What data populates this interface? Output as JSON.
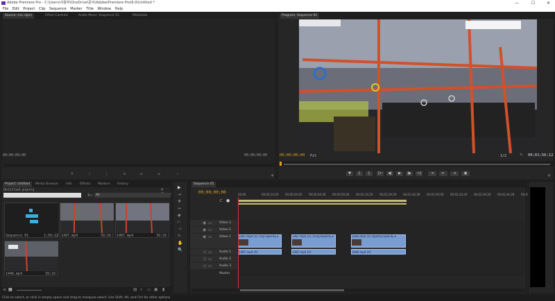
{
  "window": {
    "title": "Adobe Premiere Pro - C:\\Users\\사용자\\OneDrive\\문서\\Adobe\\Premiere Pro\\6.0\\Untitled *",
    "minimize": "—",
    "maximize": "☐",
    "close": "✕"
  },
  "menu": [
    "File",
    "Edit",
    "Project",
    "Clip",
    "Sequence",
    "Marker",
    "Title",
    "Window",
    "Help"
  ],
  "source": {
    "tabs": [
      "Source: (no clips)",
      "Effect Controls",
      "Audio Mixer: Sequence 01",
      "Metadata"
    ],
    "tc_left": "00;00;00;00",
    "tc_right": "00;00;00;00"
  },
  "program": {
    "tab": "Program: Sequence 01",
    "tc_current": "00;00;00;00",
    "fit": "Fit",
    "quality": "1/2",
    "tc_duration": "00;01;56;12",
    "transport": [
      "▼",
      "{",
      "}",
      "{←",
      "◀|",
      "▶",
      "|▶",
      "→}",
      "⇥",
      "⇤",
      "⇥",
      "▣"
    ]
  },
  "project": {
    "tabs": [
      "Project: Untitled",
      "Media Browser",
      "Info",
      "Effects",
      "Markers",
      "History"
    ],
    "file": "Untitled.prproj",
    "count": "4 Items",
    "in_label": "In:",
    "in_value": "All",
    "items": [
      {
        "name": "Sequence 01",
        "duration": "1;56;12",
        "kind": "sequence"
      },
      {
        "name": "1487.mp4",
        "duration": "39;16",
        "kind": "video"
      },
      {
        "name": "1487.mp4",
        "duration": "39;16",
        "kind": "video"
      },
      {
        "name": "1446.mp4",
        "duration": "39;16",
        "kind": "video"
      }
    ]
  },
  "tools": [
    "▶",
    "⇥",
    "✥",
    "↔",
    "◆",
    "⊢",
    "⊣",
    "✎",
    "✋",
    "🔍"
  ],
  "timeline": {
    "tab": "Sequence 01",
    "tc": "00;00;00;00",
    "ruler": [
      "00;00",
      "00;00;14;29",
      "00;00;29;29",
      "00;00;44;28",
      "00;00;59;28",
      "00;01;14;29",
      "00;01;29;29",
      "00;01;44;28",
      "00;01;59;28",
      "00;02;14;29",
      "00;02;29;29",
      "00;02;44;28",
      "00;02;59;28"
    ],
    "tracks": [
      "Video 3",
      "Video 2",
      "Video 1",
      "Audio 1",
      "Audio 2",
      "Audio 3",
      "Master"
    ],
    "video_clips": [
      "1487.mp4 [V] :city:Opacity ▾",
      "1487.mp4 [V] :acity:Opacity ▾",
      "1446.mp4 [V] Opacity:Opacity ▾"
    ],
    "audio_clips": [
      "1487.mp4 [A]",
      "1487.mp4 [A]",
      "1446.mp4 [A]"
    ]
  },
  "status": {
    "hint": "Click to select, or click in empty space and drag to marquee select. Use Shift, Alt, and Ctrl for other options."
  }
}
